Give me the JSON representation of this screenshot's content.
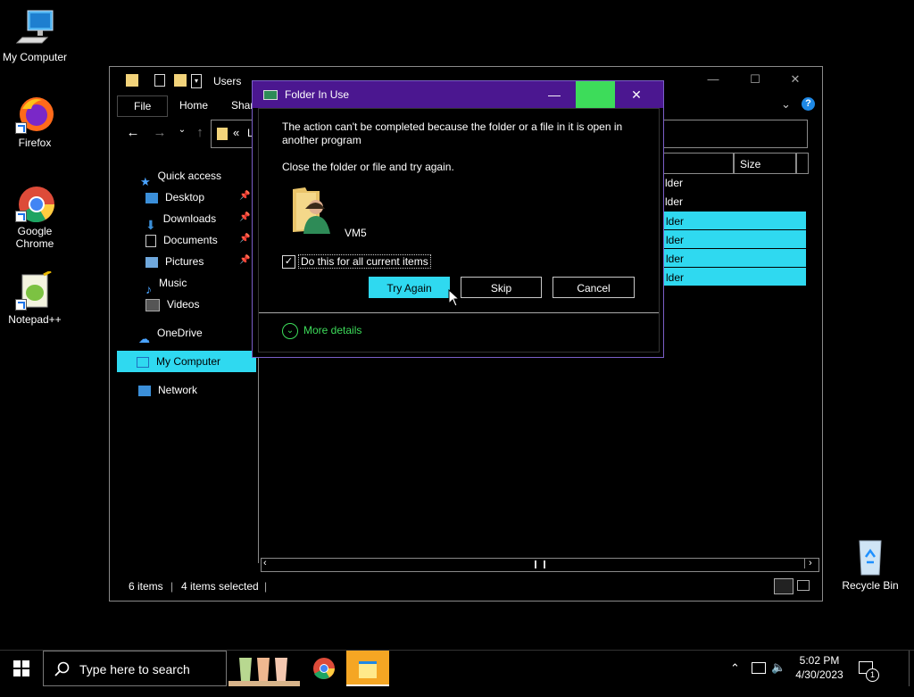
{
  "desktop": {
    "icons": [
      {
        "label": "My Computer"
      },
      {
        "label": "Firefox"
      },
      {
        "label": "Google Chrome"
      },
      {
        "label": "Notepad++"
      },
      {
        "label": "Recycle Bin"
      }
    ]
  },
  "explorer": {
    "title": "Users",
    "ribbon_tabs": [
      "File",
      "Home",
      "Share"
    ],
    "address_prefix": "«",
    "address_text": "Lo",
    "columns": {
      "size": "Size"
    },
    "sidebar": [
      {
        "label": "Quick access"
      },
      {
        "label": "Desktop"
      },
      {
        "label": "Downloads"
      },
      {
        "label": "Documents"
      },
      {
        "label": "Pictures"
      },
      {
        "label": "Music"
      },
      {
        "label": "Videos"
      },
      {
        "label": "OneDrive"
      },
      {
        "label": "My Computer"
      },
      {
        "label": "Network"
      }
    ],
    "rows": [
      {
        "type": "lder",
        "selected": false
      },
      {
        "type": "lder",
        "selected": false
      },
      {
        "type": "lder",
        "selected": true
      },
      {
        "type": "lder",
        "selected": true
      },
      {
        "type": "lder",
        "selected": true
      },
      {
        "type": "lder",
        "selected": true
      }
    ],
    "status": {
      "items": "6 items",
      "selected": "4 items selected"
    },
    "window_controls": {
      "minimize": "—",
      "maximize": "☐",
      "close": "✕"
    }
  },
  "dialog": {
    "title": "Folder In Use",
    "message_line1": "The action can't be completed because the folder or a file in it is open in",
    "message_line2": "another program",
    "instruction": "Close the folder or file and try again.",
    "item_name": "VM5",
    "checkbox_label": "Do this for all current items",
    "checkbox_checked": true,
    "buttons": {
      "try_again": "Try Again",
      "skip": "Skip",
      "cancel": "Cancel"
    },
    "more_details": "More details",
    "controls": {
      "minimize": "—",
      "close": "✕"
    }
  },
  "taskbar": {
    "search_placeholder": "Type here to search",
    "time": "5:02 PM",
    "date": "4/30/2023",
    "notification_count": "1"
  },
  "colors": {
    "accent": "#2fd9f0",
    "dialog_title": "#4b1790",
    "more_details": "#3ddc5a"
  }
}
